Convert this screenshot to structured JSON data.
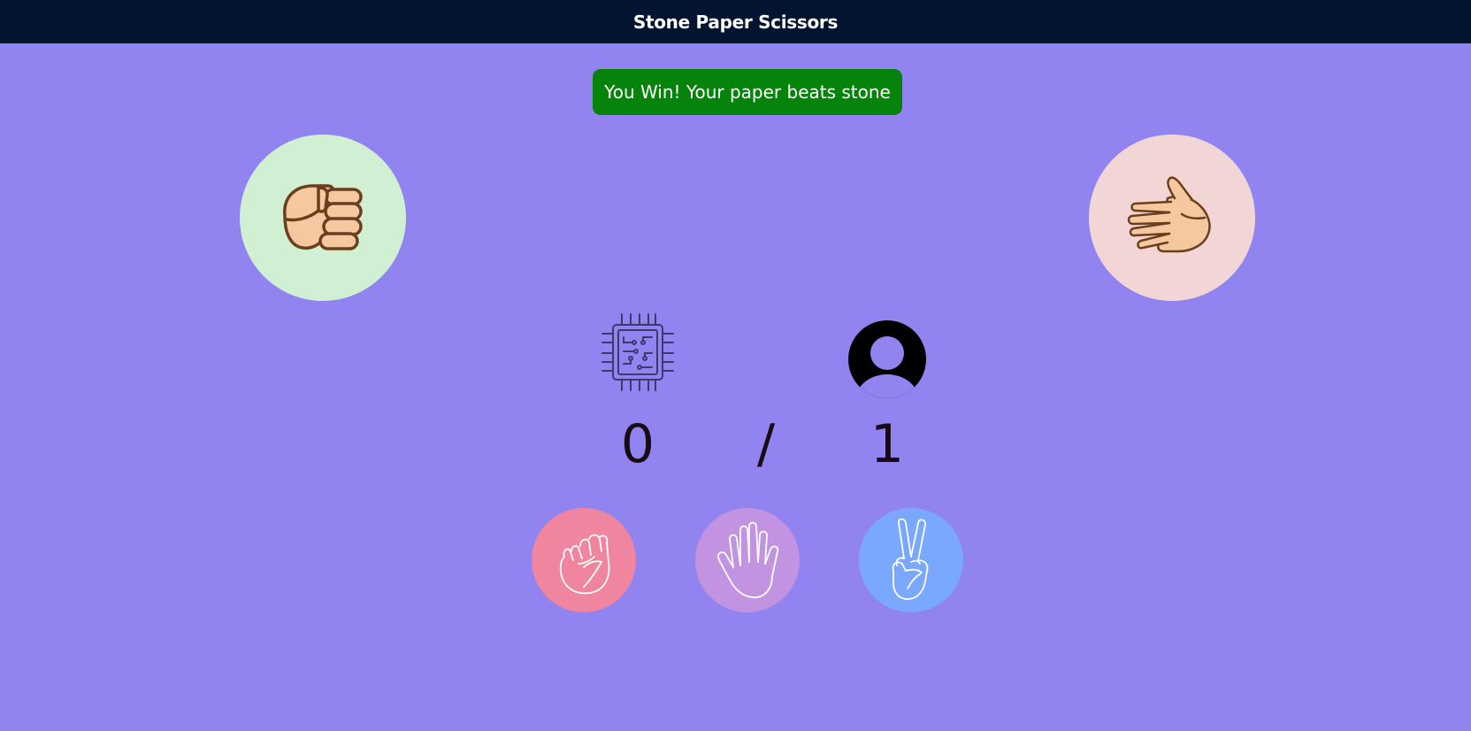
{
  "header": {
    "title": "Stone Paper Scissors"
  },
  "message": {
    "text": "You Win! Your paper beats stone",
    "color": "#06830a"
  },
  "computer_choice": {
    "icon": "fist-icon",
    "background": "#d1efd3"
  },
  "user_choice": {
    "icon": "open-hand-icon",
    "background": "#f2d6d6"
  },
  "scoreboard": {
    "computer_icon": "cpu-chip-icon",
    "user_icon": "user-avatar-icon",
    "computer_score": "0",
    "separator": "/",
    "user_score": "1"
  },
  "choices": [
    {
      "icon": "stone-fist-icon",
      "color": "#f0859f"
    },
    {
      "icon": "paper-hand-icon",
      "color": "#c193e0"
    },
    {
      "icon": "scissors-hand-icon",
      "color": "#7aa8ff"
    }
  ],
  "colors": {
    "background": "#9184f0",
    "header": "#02142f"
  }
}
